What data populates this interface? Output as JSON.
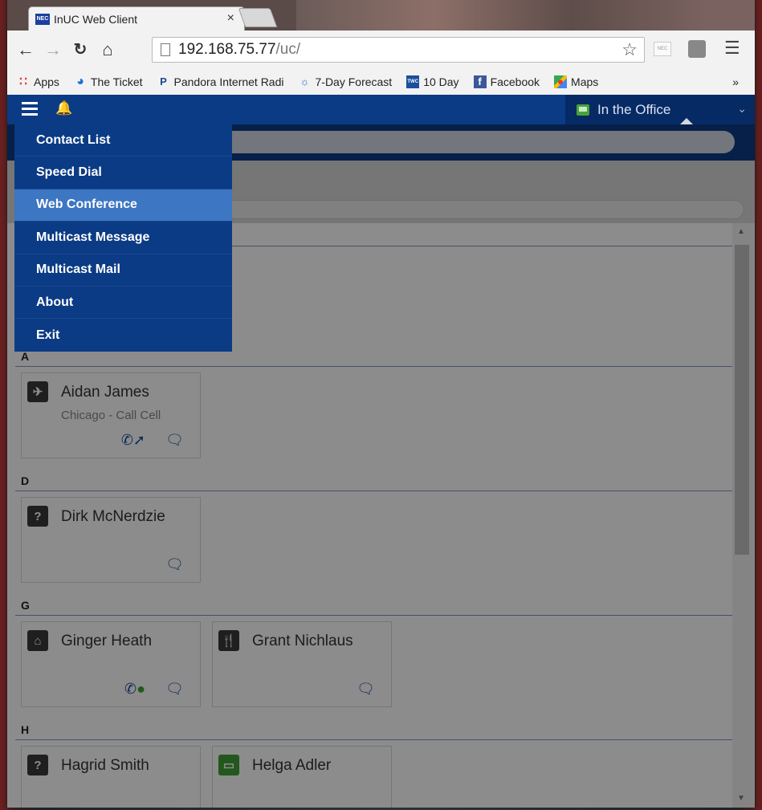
{
  "browser": {
    "tab_title": "InUC Web Client",
    "tab_close": "×",
    "url_host": "192.168.75.77",
    "url_path": "/uc/",
    "ext_label": "NEC",
    "bookmarks": [
      {
        "label": "Apps",
        "icon": "apps-grid-icon"
      },
      {
        "label": "The Ticket",
        "icon": "the-ticket-icon"
      },
      {
        "label": "Pandora Internet Radi",
        "icon": "pandora-icon"
      },
      {
        "label": "7-Day Forecast",
        "icon": "weather-icon"
      },
      {
        "label": "10 Day",
        "icon": "weather-channel-icon"
      },
      {
        "label": "Facebook",
        "icon": "facebook-icon"
      },
      {
        "label": "Maps",
        "icon": "maps-icon"
      }
    ],
    "bookmarks_more": "»"
  },
  "app": {
    "status_label": "In the Office",
    "status_color": "#3fa136",
    "brand_color": "#0b3b85",
    "menu": {
      "items": [
        {
          "label": "Contact List",
          "active": false
        },
        {
          "label": "Speed Dial",
          "active": false
        },
        {
          "label": "Web Conference",
          "active": true
        },
        {
          "label": "Multicast Message",
          "active": false
        },
        {
          "label": "Multicast Mail",
          "active": false
        },
        {
          "label": "About",
          "active": false
        },
        {
          "label": "Exit",
          "active": false
        }
      ]
    },
    "groups": {
      "a": {
        "letter": "A",
        "contacts": [
          {
            "name": "Aidan James",
            "detail": "Chicago - Call Cell",
            "status_icon": "airplane-icon"
          }
        ]
      },
      "d": {
        "letter": "D",
        "contacts": [
          {
            "name": "Dirk McNerdzie",
            "detail": "",
            "status_icon": "question-icon"
          }
        ]
      },
      "g": {
        "letter": "G",
        "contacts": [
          {
            "name": "Ginger Heath",
            "detail": "",
            "status_icon": "home-icon"
          },
          {
            "name": "Grant Nichlaus",
            "detail": "",
            "status_icon": "restaurant-icon"
          }
        ]
      },
      "h": {
        "letter": "H",
        "contacts": [
          {
            "name": "Hagrid Smith",
            "detail": "",
            "status_icon": "question-icon"
          },
          {
            "name": "Helga Adler",
            "detail": "",
            "status_icon": "desktop-icon"
          }
        ]
      }
    },
    "icons": {
      "question": "?"
    }
  }
}
